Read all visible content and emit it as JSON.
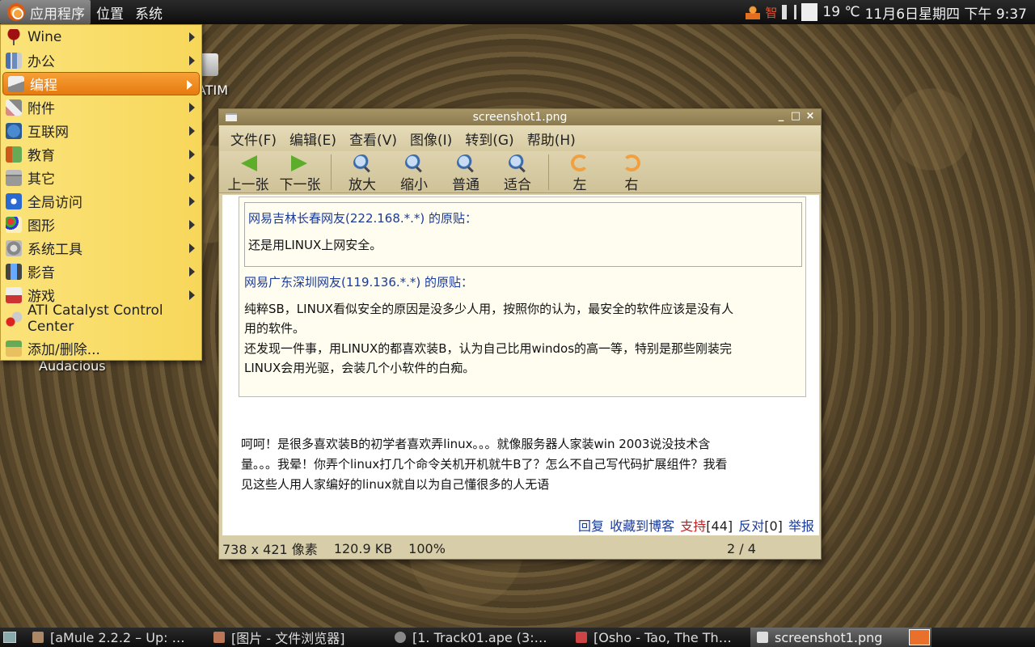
{
  "top_panel": {
    "menus": [
      "应用程序",
      "位置",
      "系统"
    ],
    "ime_indicator": "智",
    "temperature": "19 ℃",
    "clock": "11月6日星期四 下午 9:37"
  },
  "app_menu": {
    "items": [
      {
        "label": "Wine",
        "icon": "wine-icon",
        "submenu": true
      },
      {
        "label": "办公",
        "icon": "office-icon",
        "submenu": true
      },
      {
        "label": "编程",
        "icon": "programming-icon",
        "submenu": true,
        "selected": true
      },
      {
        "label": "附件",
        "icon": "accessories-icon",
        "submenu": true
      },
      {
        "label": "互联网",
        "icon": "internet-icon",
        "submenu": true
      },
      {
        "label": "教育",
        "icon": "education-icon",
        "submenu": true
      },
      {
        "label": "其它",
        "icon": "other-icon",
        "submenu": true
      },
      {
        "label": "全局访问",
        "icon": "accessibility-icon",
        "submenu": true
      },
      {
        "label": "图形",
        "icon": "graphics-icon",
        "submenu": true
      },
      {
        "label": "系统工具",
        "icon": "system-tools-icon",
        "submenu": true
      },
      {
        "label": "影音",
        "icon": "multimedia-icon",
        "submenu": true
      },
      {
        "label": "游戏",
        "icon": "games-icon",
        "submenu": true
      },
      {
        "label": "ATI Catalyst Control Center",
        "icon": "ati-icon",
        "submenu": false
      },
      {
        "label": "添加/删除...",
        "icon": "add-remove-icon",
        "submenu": false
      }
    ]
  },
  "desktop": {
    "icons": [
      {
        "label": "ATIM"
      },
      {
        "label": "Audacious"
      }
    ]
  },
  "viewer": {
    "title": "screenshot1.png",
    "menus": [
      "文件(F)",
      "编辑(E)",
      "查看(V)",
      "图像(I)",
      "转到(G)",
      "帮助(H)"
    ],
    "toolbar": {
      "prev": "上一张",
      "next": "下一张",
      "zoom_in": "放大",
      "zoom_out": "缩小",
      "normal": "普通",
      "fit": "适合",
      "rotate_left": "左",
      "rotate_right": "右"
    },
    "image_content": {
      "inner_quote_head": "网易吉林长春网友(222.168.*.*) 的原贴：",
      "inner_quote_text": "还是用LINUX上网安全。",
      "outer_quote_head": "网易广东深圳网友(119.136.*.*) 的原贴：",
      "outer_quote_text_1": "纯粹SB，LINUX看似安全的原因是没多少人用，按照你的认为，最安全的软件应该是没有人",
      "outer_quote_text_2": "用的软件。",
      "outer_quote_text_3": "还发现一件事，用LINUX的都喜欢装B，认为自己比用windos的高一等，特别是那些刚装完",
      "outer_quote_text_4": "LINUX会用光驱，会装几个小软件的白痴。",
      "post_text_1": "呵呵！是很多喜欢装B的初学者喜欢弄linux。。。就像服务器人家装win 2003说没技术含",
      "post_text_2": "量。。。我晕！你弄个linux打几个命令关机开机就牛B了？怎么不自己写代码扩展组件？我看",
      "post_text_3": "见这些人用人家编好的linux就自以为自己懂很多的人无语",
      "actions": {
        "reply": "回复",
        "bookmark": "收藏到博客",
        "support": "支持",
        "support_count": "[44]",
        "oppose": "反对",
        "oppose_count": "[0]",
        "report": "举报"
      }
    },
    "status": {
      "dimensions": "738 x 421 像素",
      "filesize": "120.9 KB",
      "zoom": "100%",
      "page": "2 / 4"
    }
  },
  "taskbar": {
    "tasks": [
      {
        "label": "[aMule 2.2.2 – Up: …",
        "icon": "amule-icon"
      },
      {
        "label": "[图片 - 文件浏览器]",
        "icon": "folder-icon"
      },
      {
        "label": "[1. Track01.ape (3:…",
        "icon": "audio-player-icon"
      },
      {
        "label": "[Osho - Tao, The Th…",
        "icon": "document-icon"
      },
      {
        "label": "screenshot1.png",
        "icon": "image-viewer-icon",
        "active": true
      }
    ]
  },
  "colors": {
    "menu_bg": "#f7d75a",
    "menu_selected": "#e67a10",
    "link_blue": "#1a3a9a",
    "support_red": "#c02020"
  }
}
